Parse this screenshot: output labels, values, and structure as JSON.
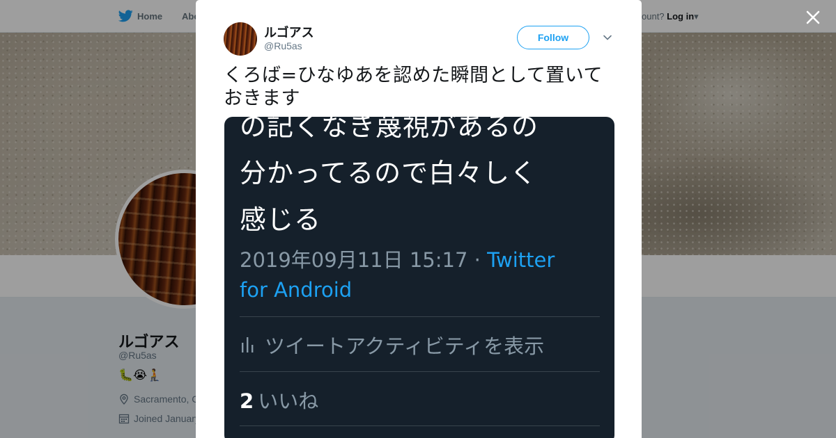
{
  "colors": {
    "accent": "#1da1f2",
    "media_bg": "#15202b",
    "overlay": "rgba(0,0,0,0.38)"
  },
  "background_page": {
    "nav": {
      "home_label": "Home",
      "about_label": "Abo",
      "login_prefix": "ccount?",
      "login_label": "Log in"
    },
    "profile": {
      "name": "ルゴアス",
      "handle": "@Ru5as",
      "bio_emoji": "🐛😭🧎",
      "location": "Sacramento, C",
      "joined": "Joined January"
    }
  },
  "modal": {
    "close_icon": "close-icon",
    "author": {
      "name": "ルゴアス",
      "handle": "@Ru5as"
    },
    "follow_label": "Follow",
    "caret_icon": "chevron-down-icon",
    "tweet_text": "くろば=ひなゆあを認めた瞬間として置いておきます",
    "media": {
      "line1": "の記くなき蔑視があるの",
      "line2": "分かってるので白々しく",
      "line3": "感じる",
      "timestamp": "2019年09月11日 15:17 · ",
      "via": "Twitter for Android",
      "activity_label": "ツイートアクティビティを表示",
      "likes_count": "2",
      "likes_label": "いいね"
    }
  }
}
